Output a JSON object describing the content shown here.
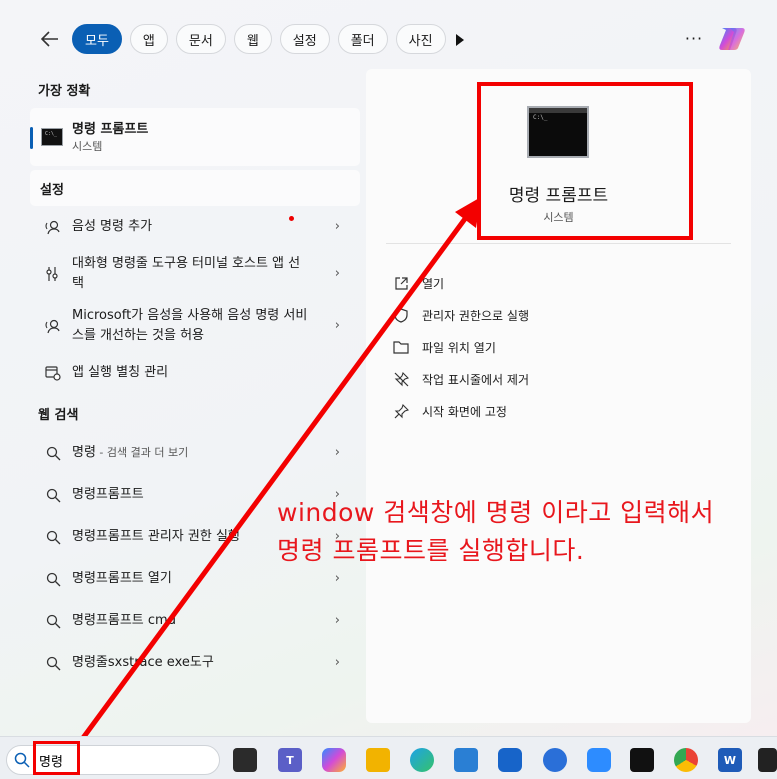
{
  "filters": {
    "back_label": "←",
    "chips": [
      "모두",
      "앱",
      "문서",
      "웹",
      "설정",
      "폴더",
      "사진"
    ],
    "more_label": "···"
  },
  "left": {
    "best_match": {
      "heading": "가장 정확",
      "title": "명령 프롬프트",
      "subtitle": "시스템"
    },
    "settings": {
      "heading": "설정",
      "items": [
        {
          "text": "음성 명령 추가",
          "icon": "speech-icon"
        },
        {
          "text": "대화형 명령줄 도구용 터미널 호스트 앱 선택",
          "icon": "terminal-settings-icon"
        },
        {
          "text": "Microsoft가 음성을 사용해 음성 명령 서비스를 개선하는 것을 허용",
          "icon": "speech-icon"
        },
        {
          "text": "앱 실행 별칭 관리",
          "icon": "app-alias-icon"
        }
      ]
    },
    "web": {
      "heading": "웹 검색",
      "items": [
        {
          "text": "명령",
          "suffix": " - 검색 결과 더 보기"
        },
        {
          "text": "명령프롬프트",
          "suffix": ""
        },
        {
          "text": "명령프롬프트 관리자 권한 실행",
          "suffix": ""
        },
        {
          "text": "명령프롬프트 열기",
          "suffix": ""
        },
        {
          "text": "명령프롬프트 cmd",
          "suffix": ""
        },
        {
          "text": "명령줄sxstrace exe도구",
          "suffix": ""
        }
      ]
    }
  },
  "right": {
    "icon_text": "C:\\_",
    "title": "명령 프롬프트",
    "subtitle": "시스템",
    "actions": [
      {
        "label": "열기",
        "icon": "open-icon"
      },
      {
        "label": "관리자 권한으로 실행",
        "icon": "shield-icon"
      },
      {
        "label": "파일 위치 열기",
        "icon": "folder-icon"
      },
      {
        "label": "작업 표시줄에서 제거",
        "icon": "unpin-icon"
      },
      {
        "label": "시작 화면에 고정",
        "icon": "pin-icon"
      }
    ]
  },
  "annotation": {
    "line1": "window 검색창에 명령 이라고 입력해서",
    "line2": "명령 프롬프트를 실행합니다."
  },
  "taskbar": {
    "search_value": "명령",
    "apps": [
      "task-view",
      "teams",
      "copilot",
      "file-explorer",
      "edge",
      "store",
      "app-grid",
      "sync",
      "zoom",
      "terminal",
      "chrome",
      "word",
      "terminal-2"
    ]
  },
  "colors": {
    "accent": "#0a5fb4",
    "annotation_red": "#f30000"
  }
}
